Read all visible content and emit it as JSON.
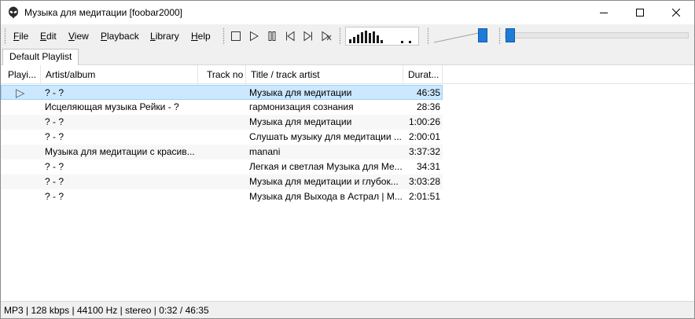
{
  "window": {
    "title": "Музыка для медитации  [foobar2000]"
  },
  "menu": {
    "items": [
      {
        "key": "F",
        "rest": "ile"
      },
      {
        "key": "E",
        "rest": "dit"
      },
      {
        "key": "V",
        "rest": "iew"
      },
      {
        "key": "P",
        "rest": "layback"
      },
      {
        "key": "L",
        "rest": "ibrary"
      },
      {
        "key": "H",
        "rest": "elp"
      }
    ]
  },
  "toolbar": {
    "buttons": [
      "stop-icon",
      "play-icon",
      "pause-icon",
      "previous-icon",
      "next-icon",
      "random-icon"
    ],
    "volume_fraction": 0.88,
    "seek_fraction": 0.012
  },
  "tabs": [
    {
      "label": "Default Playlist",
      "active": true
    }
  ],
  "playlist": {
    "columns": [
      "Playi...",
      "Artist/album",
      "Track no",
      "Title / track artist",
      "Durat..."
    ],
    "rows": [
      {
        "playing": "▷",
        "artist": "? - ?",
        "track": "",
        "title": "Музыка для медитации",
        "duration": "46:35"
      },
      {
        "playing": "",
        "artist": "Исцеляющая музыка Рейки - ?",
        "track": "",
        "title": "гармонизация сознания",
        "duration": "28:36"
      },
      {
        "playing": "",
        "artist": "? - ?",
        "track": "",
        "title": "Музыка для медитации",
        "duration": "1:00:26"
      },
      {
        "playing": "",
        "artist": "? - ?",
        "track": "",
        "title": "Слушать музыку для медитации ...",
        "duration": "2:00:01"
      },
      {
        "playing": "",
        "artist": "Музыка для медитации с красив...",
        "track": "",
        "title": "manani",
        "duration": "3:37:32"
      },
      {
        "playing": "",
        "artist": "? - ?",
        "track": "",
        "title": "Легкая и светлая Музыка для Ме...",
        "duration": "34:31"
      },
      {
        "playing": "",
        "artist": "? - ?",
        "track": "",
        "title": "Музыка для медитации и глубок...",
        "duration": "3:03:28"
      },
      {
        "playing": "",
        "artist": "? - ?",
        "track": "",
        "title": "Музыка для Выхода в Астрал | М...",
        "duration": "2:01:51"
      }
    ]
  },
  "status": {
    "text": "MP3 | 128 kbps | 44100 Hz | stereo | 0:32 / 46:35"
  }
}
